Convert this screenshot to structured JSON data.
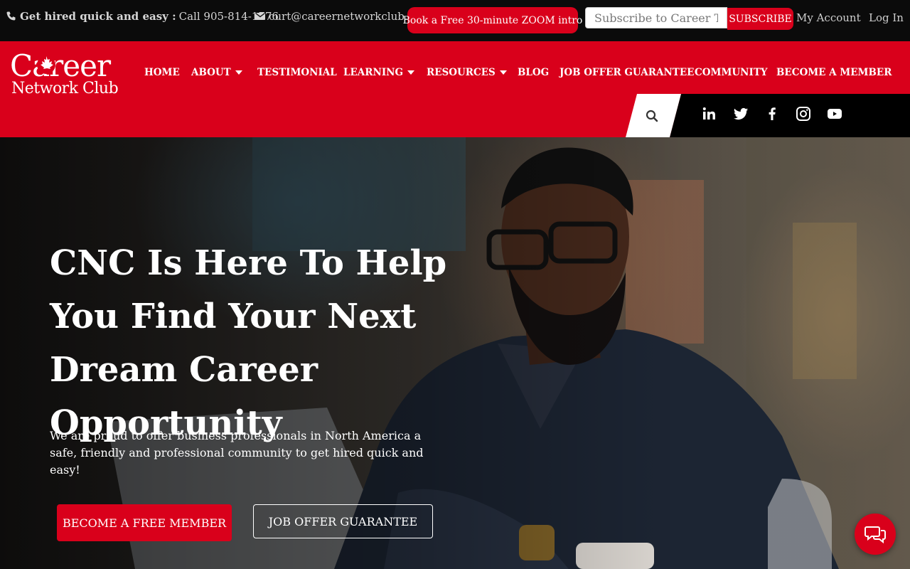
{
  "topbar": {
    "phone_bold": "Get hired quick and easy :",
    "phone_text": "Call 905-814-1776",
    "email": "curt@careernetworkclub.ca",
    "zoom_button": "Book a Free 30-minute ZOOM intro",
    "subscribe_placeholder": "Subscribe to Career Tip",
    "subscribe_button": "SUBSCRIBE",
    "my_account": "My Account",
    "log_in": "Log In"
  },
  "logo": {
    "line1": "Career",
    "line2": "Network Club"
  },
  "nav": {
    "items": [
      {
        "label": "HOME",
        "dropdown": false
      },
      {
        "label": "ABOUT",
        "dropdown": true
      },
      {
        "label": "TESTIMONIAL",
        "dropdown": false
      },
      {
        "label": "LEARNING",
        "dropdown": true
      },
      {
        "label": "RESOURCES",
        "dropdown": true
      },
      {
        "label": "BLOG",
        "dropdown": false
      },
      {
        "label": "JOB OFFER GUARANTEE",
        "dropdown": false
      },
      {
        "label": "COMMUNITY",
        "dropdown": false
      },
      {
        "label": "BECOME A MEMBER",
        "dropdown": false
      }
    ]
  },
  "social": [
    "linkedin-icon",
    "twitter-icon",
    "facebook-icon",
    "instagram-icon",
    "youtube-icon"
  ],
  "hero": {
    "title": "CNC Is Here To Help You Find Your Next Dream Career Opportunity",
    "subtitle": "We are proud to offer business professionals in North America a safe, friendly and professional community to get hired quick and easy!",
    "primary_button": "BECOME A FREE MEMBER",
    "secondary_button": "JOB OFFER GUARANTEE"
  },
  "colors": {
    "brand_red": "#d9001b",
    "topbar_bg": "#0b0b0b",
    "social_bg": "#000000"
  }
}
